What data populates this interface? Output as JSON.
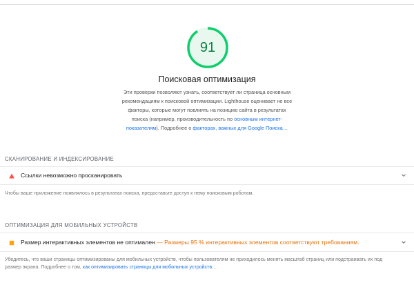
{
  "category": {
    "score": "91",
    "title": "Поисковая оптимизация",
    "description_lines": [
      "Эти проверки позволяют узнать, соответствует ли страница основным",
      "рекомендациям к поисковой оптимизации. Lighthouse оценивает не все",
      "факторы, которые могут повлиять на позицию сайта в результатах"
    ],
    "description_line4_prefix": "поиска (например, производительность по ",
    "description_link1": "основным интернет-показателям",
    "description_line5_suffix": "). Подробнее о ",
    "description_link2": "факторах, важных для Google Поиска",
    "description_ellipsis": "…"
  },
  "groups": [
    {
      "title": "СКАНИРОВАНИЕ И ИНДЕКСИРОВАНИЕ",
      "audit": {
        "label": "Ссылки невозможно просканировать",
        "status_icon": "fail-triangle-icon"
      },
      "description": "Чтобы ваше приложение появлялось в результатах поиска, предоставьте доступ к нему поисковым роботам."
    },
    {
      "title": "ОПТИМИЗАЦИЯ ДЛЯ МОБИЛЬНЫХ УСТРОЙСТВ",
      "audit": {
        "label": "Размер интерактивных элементов не оптимален",
        "separator": " — ",
        "display_value": "Размеры 95 % интерактивных элементов соответствуют требованиям.",
        "status_icon": "average-square-icon"
      },
      "description_line1": "Убедитесь, что ваши страницы оптимизированы для мобильных устройств, чтобы пользователям не приходилось менять масштаб страниц или подстраивать их под",
      "description_line2_prefix": "размер экрана. Подробнее о том, ",
      "description_link": "как оптимизировать страницы для мобильных устройств",
      "description_ellipsis": "…"
    }
  ],
  "colors": {
    "pass": "#0cce6b",
    "fail": "#ff4e42",
    "average": "#ffa400",
    "link": "#1a73e8"
  }
}
